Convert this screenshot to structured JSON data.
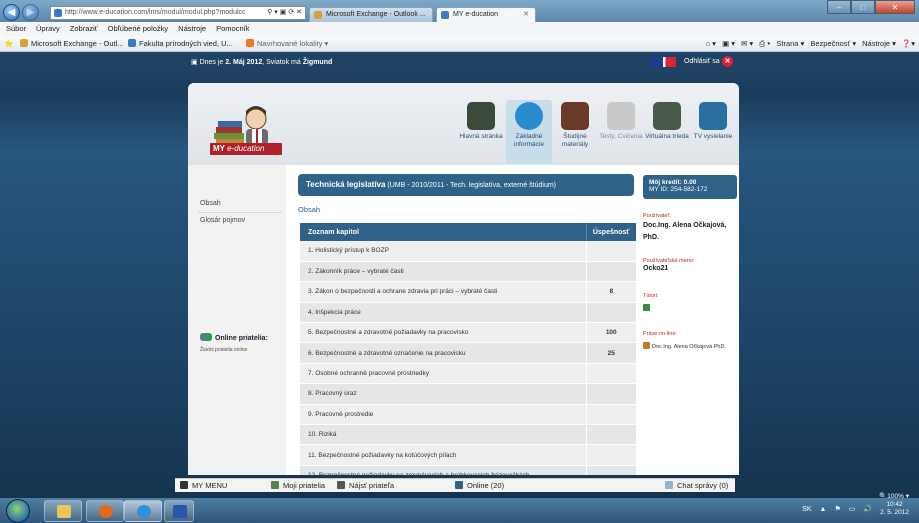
{
  "browser": {
    "url": "http://www.e-ducation.com/lms/modul/modul.php?modulcc",
    "url_host_bold": "e-ducation.com",
    "tabs": [
      {
        "label": "Microsoft Exchange - Outlook ...",
        "color": "#d8a23a"
      },
      {
        "label": "MY e-ducation",
        "color": "#3a7cc4"
      }
    ],
    "menu": [
      "Súbor",
      "Úpravy",
      "Zobraziť",
      "Obľúbené položky",
      "Nástroje",
      "Pomocník"
    ],
    "favorites": [
      {
        "label": "Microsoft Exchange - Outl...",
        "color": "#d8a23a"
      },
      {
        "label": "Fakulta prírodných vied, U...",
        "color": "#3a7cc4"
      },
      {
        "label": "Navrhované lokality ▾",
        "color": "#f07820"
      }
    ],
    "command_bar": [
      "Strana ▾",
      "Bezpečnosť ▾",
      "Nástroje ▾"
    ],
    "zoom": "100%"
  },
  "topstrip": {
    "date_prefix": "Dnes je",
    "date": "2. Máj 2012",
    "name_prefix": ", Sviatok má",
    "name": "Žigmund",
    "logout": "Odhlásiť sa"
  },
  "nav": [
    {
      "label": "Hlavná stránka",
      "icon": "home-icon",
      "color": "#3c4a3c"
    },
    {
      "label": "Základné informácie",
      "icon": "info-icon",
      "color": "#2a8ccf",
      "active": true
    },
    {
      "label": "Študijné materiály",
      "icon": "books-icon",
      "color": "#6a3a2a"
    },
    {
      "label": "Testy, Cvičenia",
      "icon": "test-icon",
      "color": "#c9c9c9",
      "disabled": true
    },
    {
      "label": "Virtuálna trieda",
      "icon": "class-icon",
      "color": "#4a5a4a"
    },
    {
      "label": "TV vysielanie",
      "icon": "tv-icon",
      "color": "#2a6fa0"
    }
  ],
  "logo": {
    "my": "MY",
    "rest": "e-ducation"
  },
  "leftmenu": {
    "items": [
      "Obsah",
      "Glosár pojmov"
    ],
    "friends_title": "Online priatelia:",
    "friends_empty": "Žiadni priatelia online"
  },
  "course": {
    "title": "Technická legislatíva",
    "subtitle": "(UMB - 2010/2011 - Tech. legislatíva, externé štúdium)",
    "breadcrumb": "Obsah"
  },
  "table": {
    "headers": [
      "Zoznam kapitol",
      "Úspešnosť"
    ],
    "rows": [
      {
        "title": "1. Holistický prístup k BOZP",
        "score": ""
      },
      {
        "title": "2. Zákonník práce – vybraté časti",
        "score": ""
      },
      {
        "title": "3. Zákon o bezpečnosti a ochrane zdravia pri práci – vybraté časti",
        "score": "8"
      },
      {
        "title": "4. Inšpekcia práce",
        "score": ""
      },
      {
        "title": "5. Bezpečnostné a zdravotné požiadavky na pracovisko",
        "score": "100"
      },
      {
        "title": "6. Bezpečnostné a zdravotné označenie na pracovisku",
        "score": "25"
      },
      {
        "title": "7. Osobné ochranné pracovné prostriedky",
        "score": ""
      },
      {
        "title": "8. Pracovný úraz",
        "score": ""
      },
      {
        "title": "9. Pracovné prostredie",
        "score": ""
      },
      {
        "title": "10. Riziká",
        "score": ""
      },
      {
        "title": "11. Bezpečnostné požiadavky na kotúčových pílach",
        "score": ""
      },
      {
        "title": "12. Bezpečnostné požiadavky na zrovnávacích a hrúbkovacích frézovačkách",
        "score": ""
      }
    ]
  },
  "sidebar": {
    "credit_label": "Môj kredit: 0.00",
    "my_id": "MY ID: 254-582-172",
    "user_label": "Používateľ:",
    "user_value": "Doc.Ing. Alena Očkajová, PhD.",
    "username_label": "Používateľské meno:",
    "username_value": "Ocko21",
    "tutors_label": "Tútori:",
    "online_label": "Práve on-line:",
    "online_value": "Doc.Ing. Alena Očkajová PhD."
  },
  "socialbar": {
    "menu": "MY MENU",
    "friends": "Moji priatelia",
    "find": "Nájsť priateľa",
    "online": "Online (20)",
    "chat": "Chat správy (0)"
  },
  "taskbar": {
    "lang": "SK",
    "time": "10:42",
    "date": "2. 5. 2012"
  }
}
